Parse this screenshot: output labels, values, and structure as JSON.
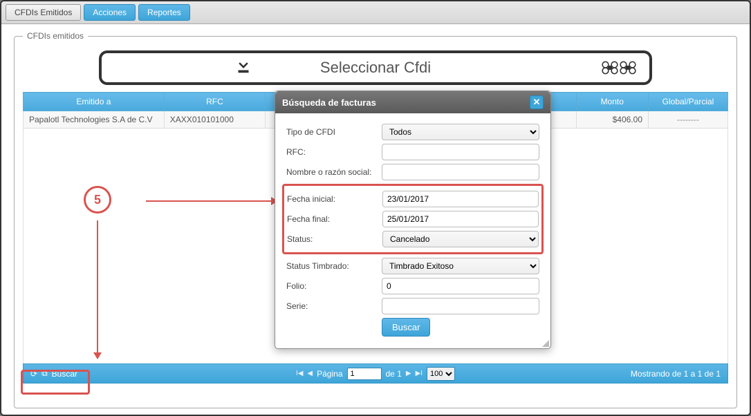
{
  "tabs": {
    "emitted": "CFDIs Emitidos",
    "actions": "Acciones",
    "reports": "Reportes"
  },
  "fieldset_legend": "CFDIs emitidos",
  "selector_title": "Seleccionar Cfdi",
  "columns": {
    "emitido": "Emitido a",
    "rfc": "RFC",
    "monto": "Monto",
    "global": "Global/Parcial"
  },
  "row": {
    "emitido": "Papalotl Technologies S.A de C.V",
    "rfc": "XAXX010101000",
    "monto": "$406.00",
    "global": "--------"
  },
  "pager": {
    "buscar": "Buscar",
    "pagina_lbl": "Página",
    "page_value": "1",
    "de": "de 1",
    "per_page": "100",
    "showing": "Mostrando de 1 a 1 de 1"
  },
  "annotation": {
    "num": "5"
  },
  "dialog": {
    "title": "Búsqueda de facturas",
    "labels": {
      "tipo": "Tipo de CFDI",
      "rfc": "RFC:",
      "nombre": "Nombre o razón social:",
      "fini": "Fecha inicial:",
      "ffin": "Fecha final:",
      "status": "Status:",
      "status_timbrado": "Status Timbrado:",
      "folio": "Folio:",
      "serie": "Serie:"
    },
    "values": {
      "tipo": "Todos",
      "rfc": "",
      "nombre": "",
      "fini": "23/01/2017",
      "ffin": "25/01/2017",
      "status": "Cancelado",
      "status_timbrado": "Timbrado Exitoso",
      "folio": "0",
      "serie": ""
    },
    "buscar_btn": "Buscar"
  }
}
